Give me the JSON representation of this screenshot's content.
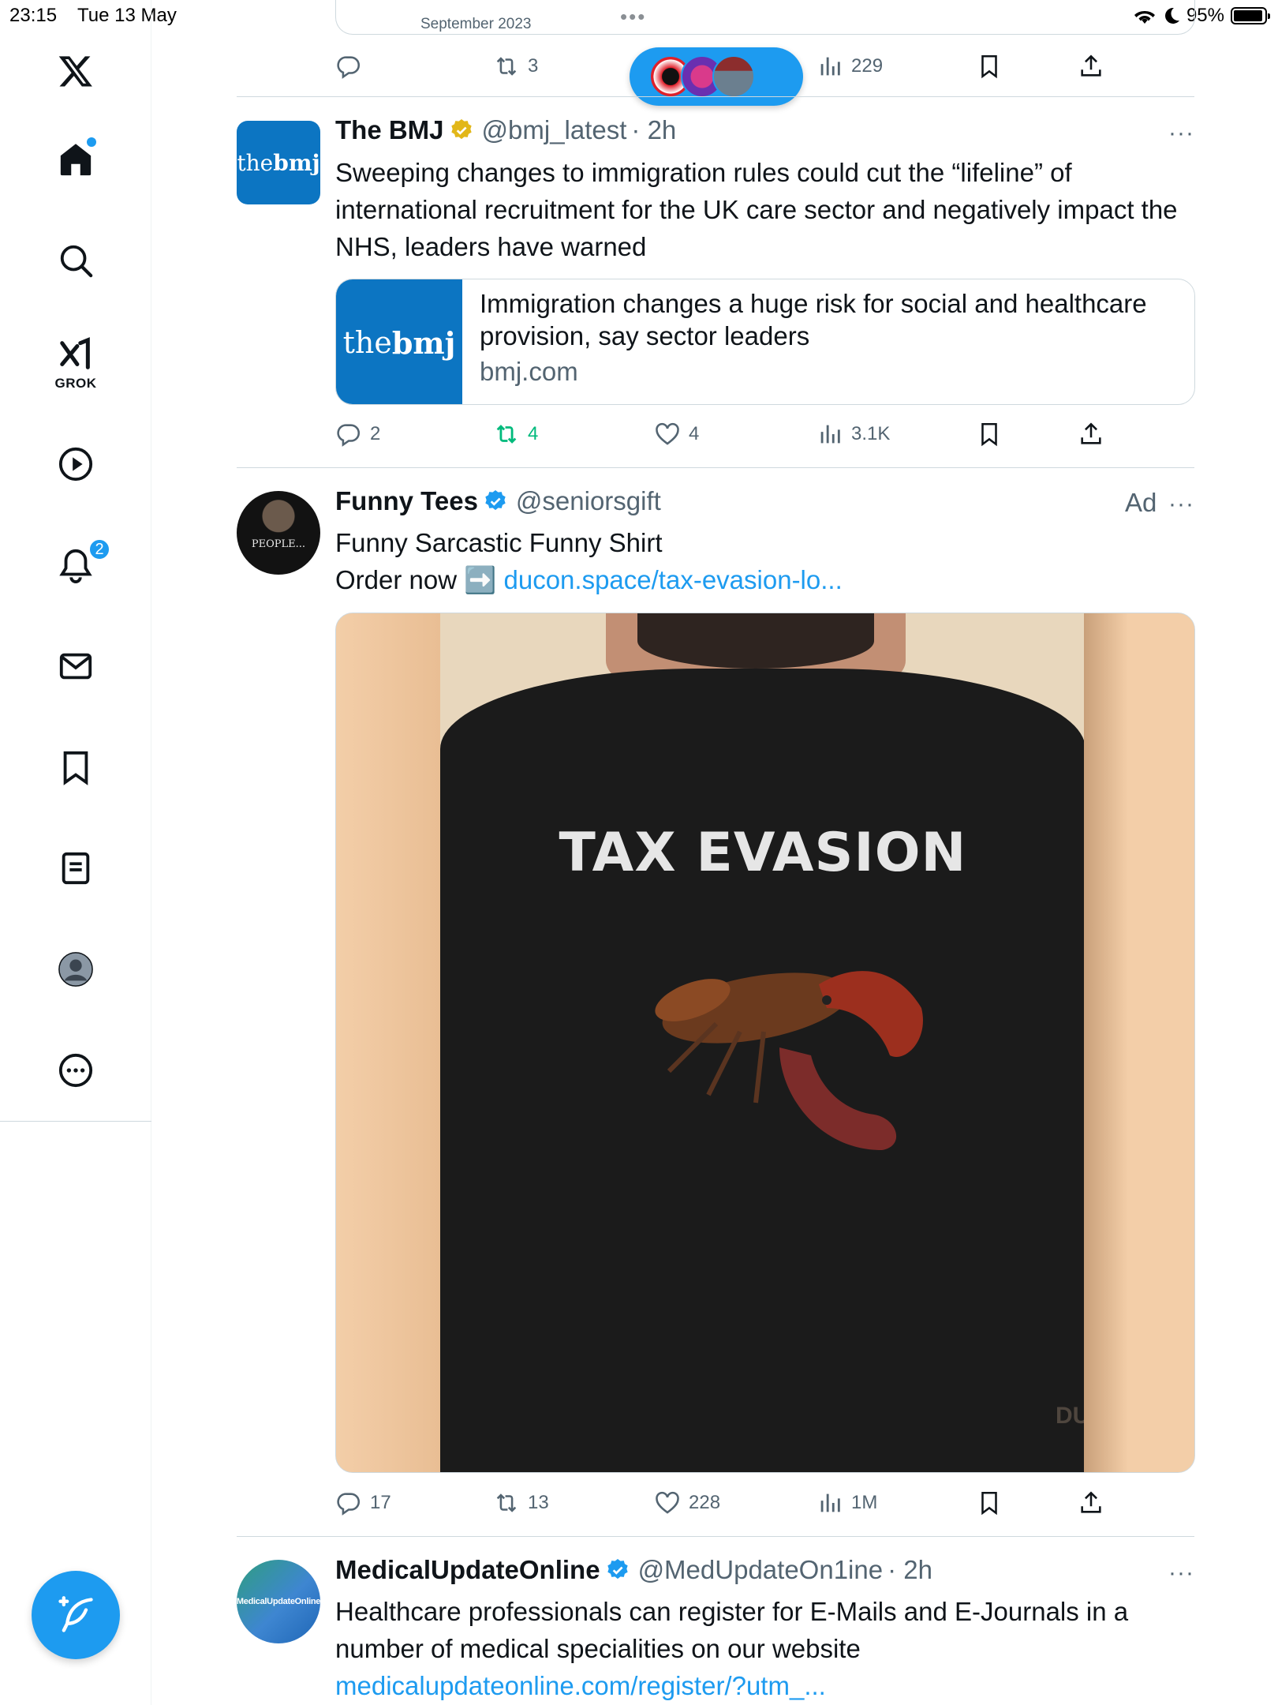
{
  "status_bar": {
    "time": "23:15",
    "date": "Tue 13 May",
    "battery": "95%",
    "battery_level": 0.95
  },
  "top_handle": "•••",
  "nav": {
    "grok_label": "GROK",
    "notifications_badge": "2"
  },
  "previous_tweet": {
    "card_caption": "September 2023",
    "retweets": "3",
    "views": "229"
  },
  "new_posts_pill": {
    "arrow": "↑"
  },
  "tweets": [
    {
      "name": "The BMJ",
      "handle": "@bmj_latest",
      "time": "· 2h",
      "avatar_text_light": "the",
      "avatar_text_bold": "bmj",
      "text": "Sweeping changes to immigration rules could cut the “lifeline” of international recruitment for the UK care sector and negatively impact the NHS, leaders have warned",
      "card": {
        "title": "Immigration changes a huge risk for social and healthcare provision, say sector leaders",
        "domain": "bmj.com",
        "thumb_light": "the",
        "thumb_bold": "bmj"
      },
      "replies": "2",
      "retweets": "4",
      "likes": "4",
      "views": "3.1K",
      "more": "···"
    },
    {
      "name": "Funny Tees",
      "handle": "@seniorsgift",
      "avatar_text": "PEOPLE...",
      "ad_label": "Ad",
      "line1": "Funny Sarcastic Funny Shirt",
      "line2_prefix": "Order now ➡️ ",
      "link": "ducon.space/tax-evasion-lo...",
      "media_text": "TAX EVASION",
      "media_watermark": "DUCON",
      "replies": "17",
      "retweets": "13",
      "likes": "228",
      "views": "1M",
      "more": "···"
    },
    {
      "name": "MedicalUpdateOnline",
      "handle": "@MedUpdateOn1ine",
      "time": "· 2h",
      "avatar_text": "MedicalUpdateOnline",
      "text": "Healthcare professionals can register for E-Mails and E-Journals in a number of medical specialities on our website",
      "link": "medicalupdateonline.com/register/?utm_...",
      "more": "···"
    }
  ],
  "colors": {
    "accent": "#1d9bf0",
    "retweet_active": "#00ba7c",
    "muted": "#536471",
    "bmj_blue": "#0c75c2",
    "verified_gold": "#e2b719"
  }
}
